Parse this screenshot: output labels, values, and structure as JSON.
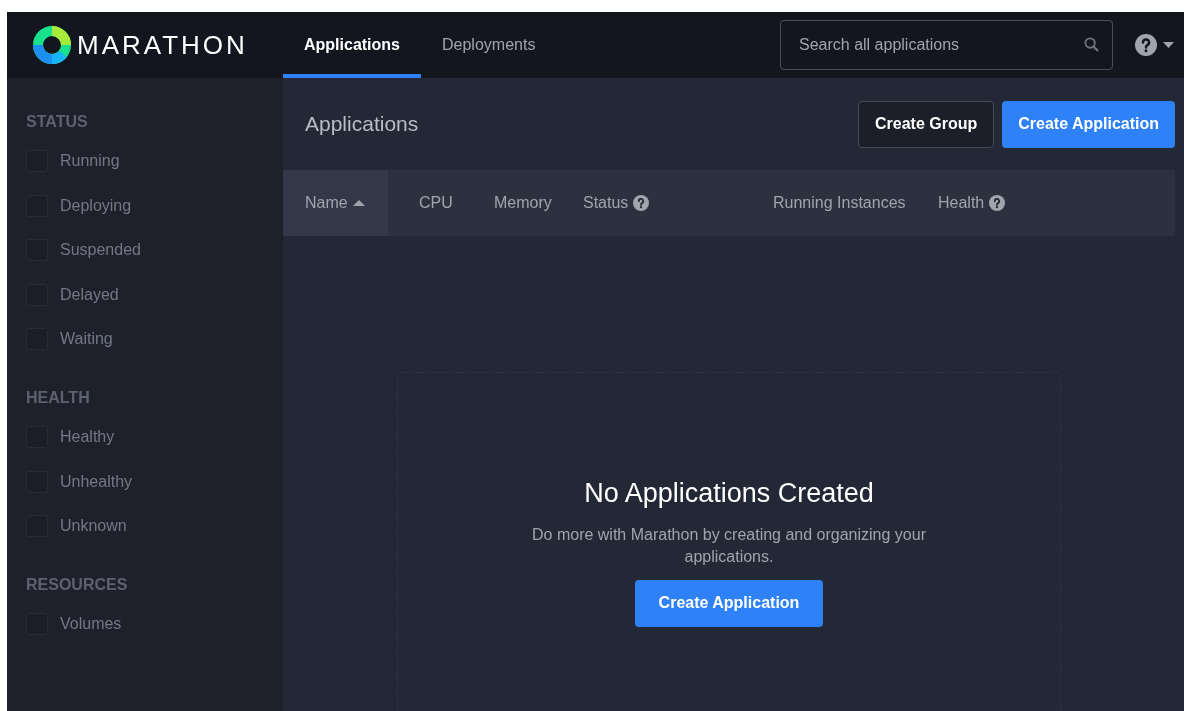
{
  "brand": "MARATHON",
  "nav_tabs": [
    {
      "label": "Applications",
      "selected": true
    },
    {
      "label": "Deployments",
      "selected": false
    }
  ],
  "search": {
    "placeholder": "Search all applications"
  },
  "sidebar": [
    {
      "title": "STATUS",
      "items": [
        {
          "label": "Running",
          "checked": false
        },
        {
          "label": "Deploying",
          "checked": false
        },
        {
          "label": "Suspended",
          "checked": false
        },
        {
          "label": "Delayed",
          "checked": false
        },
        {
          "label": "Waiting",
          "checked": false
        }
      ]
    },
    {
      "title": "HEALTH",
      "items": [
        {
          "label": "Healthy",
          "checked": false
        },
        {
          "label": "Unhealthy",
          "checked": false
        },
        {
          "label": "Unknown",
          "checked": false
        }
      ]
    },
    {
      "title": "RESOURCES",
      "items": [
        {
          "label": "Volumes",
          "checked": false
        }
      ]
    }
  ],
  "page_title": "Applications",
  "actions": [
    {
      "label": "Create Group",
      "kind": "secondary"
    },
    {
      "label": "Create Application",
      "kind": "primary"
    }
  ],
  "table": {
    "columns": [
      {
        "label": "Name",
        "sorted": true,
        "help": false
      },
      {
        "label": "CPU",
        "sorted": false,
        "help": false
      },
      {
        "label": "Memory",
        "sorted": false,
        "help": false
      },
      {
        "label": "Status",
        "sorted": false,
        "help": true
      },
      {
        "label": "Running Instances",
        "sorted": false,
        "help": false
      },
      {
        "label": "Health",
        "sorted": false,
        "help": true
      }
    ]
  },
  "empty_state": {
    "title": "No Applications Created",
    "message": "Do more with Marathon by creating and organizing your applications.",
    "button": "Create Application"
  }
}
